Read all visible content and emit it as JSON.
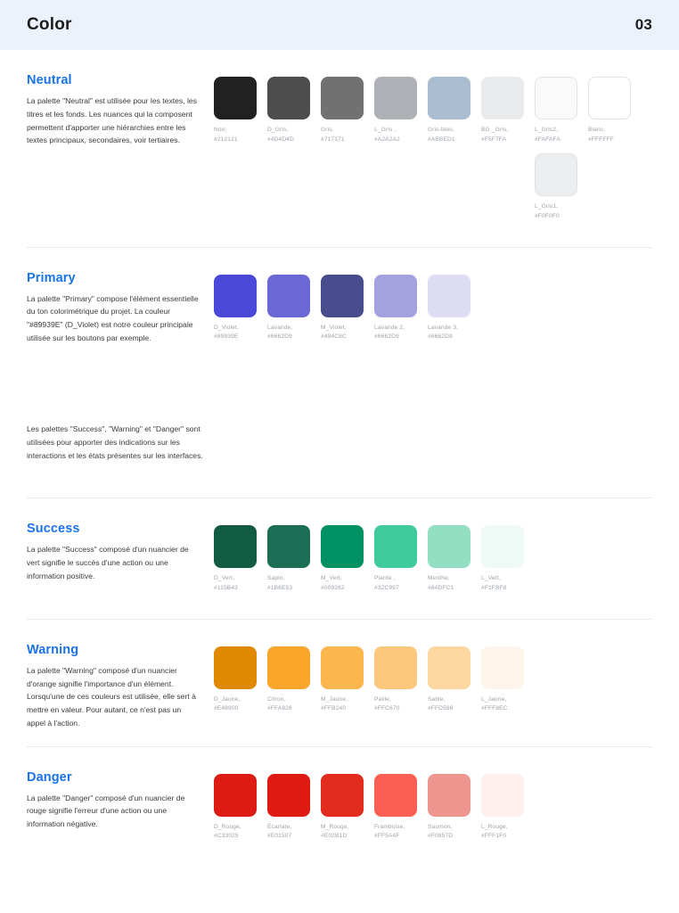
{
  "header": {
    "title": "Color",
    "page_number": "03"
  },
  "theme": {
    "header_background": "#EBF2FB",
    "heading_color": "#1A73E8",
    "body_text_color": "#3A3A3A",
    "label_color": "#9AA2AA",
    "divider_color": "#E5EAF0",
    "page_background": "#FFFFFF"
  },
  "sections": [
    {
      "id": "neutral",
      "heading": "Neutral",
      "description": "La palette \"Neutral\" est utilisée pour les textes, les titres et les fonds. Les nuances qui la composent permettent d'apporter une hiérarchies entre les textes principaux, secondaires, voir tertiaires.",
      "swatches": [
        {
          "name": "Noir,",
          "hex_label": "#212121",
          "swatch_color": "#212121",
          "bordered": false
        },
        {
          "name": "D_Gris,",
          "hex_label": "#4D4D4D",
          "swatch_color": "#4D4D4D",
          "bordered": false
        },
        {
          "name": "Gris,",
          "hex_label": "#717171",
          "swatch_color": "#717171",
          "bordered": false
        },
        {
          "name": "L_Gris ,",
          "hex_label": "#A2A2A2",
          "swatch_color": "#AEB2B6",
          "bordered": false
        },
        {
          "name": "Gris-bleu,",
          "hex_label": "#ABBED1",
          "swatch_color": "#ABBED1",
          "bordered": false
        },
        {
          "name": "BG _Gris,",
          "hex_label": "#F5F7FA",
          "swatch_color": "#E9EAEC",
          "bordered": false
        },
        {
          "name": "L_Gris2,",
          "hex_label": "#FAFAFA",
          "swatch_color": "#FAFAFA",
          "bordered": true
        },
        {
          "name": "Blanc,",
          "hex_label": "#FFFFFF",
          "swatch_color": "#FFFFFF",
          "bordered": true
        },
        {
          "spacer": true
        },
        {
          "spacer": true
        },
        {
          "spacer": true
        },
        {
          "spacer": true
        },
        {
          "spacer": true
        },
        {
          "spacer": true
        },
        {
          "name": "L_Gris1,",
          "hex_label": "#F0F0F0",
          "swatch_color": "#EDEEF0",
          "bordered": true
        },
        {
          "spacer": true
        }
      ]
    },
    {
      "id": "primary",
      "heading": "Primary",
      "description": "La palette \"Primary\" compose l'élément essentielle du ton colorimétrique du projet. La couleur \"#89939E\" (D_Violet) est notre couleur principale utilisée sur les boutons par exemple.",
      "swatches": [
        {
          "name": "D_Violet,",
          "hex_label": "#89939E",
          "swatch_color": "#4A48D8",
          "bordered": false
        },
        {
          "name": "Lavande,",
          "hex_label": "#6662D9",
          "swatch_color": "#6A68D6",
          "bordered": false
        },
        {
          "name": "M_Violet,",
          "hex_label": "#494C8C",
          "swatch_color": "#494C8C",
          "bordered": false
        },
        {
          "name": "Lavande 2,",
          "hex_label": "#6662D9",
          "swatch_color": "#A5A2E0",
          "bordered": false
        },
        {
          "name": "Lavande 3,",
          "hex_label": "#6662D9",
          "swatch_color": "#DEDCF3",
          "bordered": false
        }
      ]
    },
    {
      "id": "success",
      "heading": "Success",
      "description": "La palette \"Success\" composé d'un nuancier de vert signifie le succès d'une action ou une information positive.",
      "swatches": [
        {
          "name": "D_Vert,",
          "hex_label": "#115B43",
          "swatch_color": "#115B43",
          "bordered": false
        },
        {
          "name": "Sapin,",
          "hex_label": "#1B6E53",
          "swatch_color": "#1B6E53",
          "bordered": false
        },
        {
          "name": "M_Vert,",
          "hex_label": "#009262",
          "swatch_color": "#009262",
          "bordered": false
        },
        {
          "name": "Plante ,",
          "hex_label": "#32C997",
          "swatch_color": "#3FCB9B",
          "bordered": false
        },
        {
          "name": "Menthe,",
          "hex_label": "#84DFC1",
          "swatch_color": "#93DFC4",
          "bordered": false
        },
        {
          "name": "L_Vert,",
          "hex_label": "#F1FBF8",
          "swatch_color": "#EEFAF5",
          "bordered": false
        }
      ]
    },
    {
      "id": "warning",
      "heading": "Warning",
      "description": "La palette \"Warning\" composé d'un nuancier d'orange signifie l'importance d'un élément. Lorsqu'une de ces couleurs est utilisée, elle sert à mettre en valeur. Pour autant, ce n'est pas un appel à l'action.",
      "swatches": [
        {
          "name": "D_Jaune,",
          "hex_label": "#E48900",
          "swatch_color": "#E08A04",
          "bordered": false
        },
        {
          "name": "Citron,",
          "hex_label": "#FFA826",
          "swatch_color": "#F9A62B",
          "bordered": false
        },
        {
          "name": "M_Jaune,",
          "hex_label": "#FFB240",
          "swatch_color": "#FBB74D",
          "bordered": false
        },
        {
          "name": "Paille,",
          "hex_label": "#FFC670",
          "swatch_color": "#FBC77C",
          "bordered": false
        },
        {
          "name": "Sable,",
          "hex_label": "#FFD596",
          "swatch_color": "#FCD7A0",
          "bordered": false
        },
        {
          "name": "L_Jaune,",
          "hex_label": "#FFF8EC",
          "swatch_color": "#FDF5EA",
          "bordered": false
        }
      ]
    },
    {
      "id": "danger",
      "heading": "Danger",
      "description": "La palette \"Danger\" composé d'un nuancier de rouge signifie l'erreur d'une action ou une information négative.",
      "swatches": [
        {
          "name": "D_Rouge,",
          "hex_label": "#C33025",
          "swatch_color": "#DC1C13",
          "bordered": false
        },
        {
          "name": "Écarlate,",
          "hex_label": "#E01507",
          "swatch_color": "#DE1A11",
          "bordered": false
        },
        {
          "name": "M_Rouge,",
          "hex_label": "#E02B1D",
          "swatch_color": "#E02B1D",
          "bordered": false
        },
        {
          "name": "Framboise,",
          "hex_label": "#FF5A4F",
          "swatch_color": "#FB5F53",
          "bordered": false
        },
        {
          "name": "Saumon,",
          "hex_label": "#F0857D",
          "swatch_color": "#EE968F",
          "bordered": false
        },
        {
          "name": "L_Rouge,",
          "hex_label": "#FFF1F0",
          "swatch_color": "#FDF0EF",
          "bordered": false
        }
      ]
    }
  ],
  "intro_paragraph": "Les palettes \"Success\", \"Warning\" et \"Danger\" sont utilisées pour apporter des indications sur les interactions et les états présentes sur les interfaces."
}
